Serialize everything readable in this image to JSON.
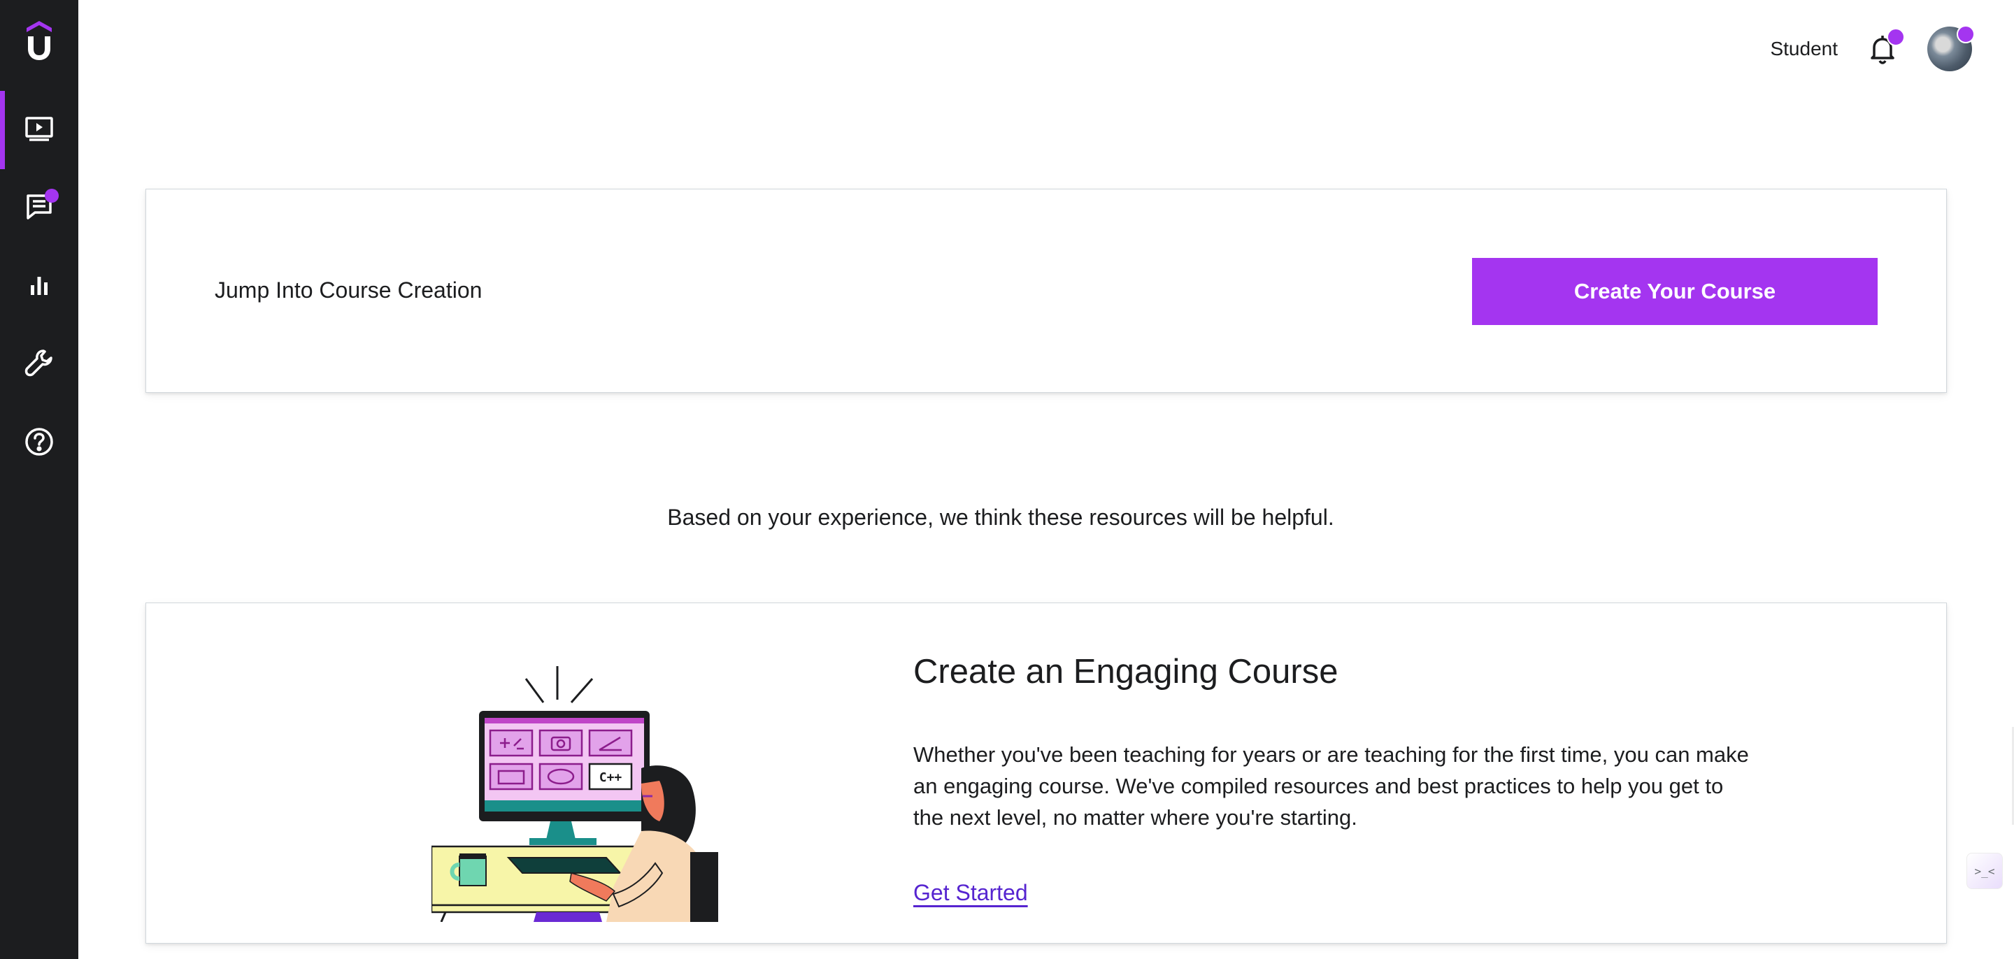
{
  "app": {
    "brand_letter": "U"
  },
  "colors": {
    "accent": "#a435f0",
    "sidebar_bg": "#1c1d1f",
    "link": "#5624d0"
  },
  "sidebar": {
    "items": [
      {
        "icon": "video-course-icon",
        "active": true
      },
      {
        "icon": "messages-icon",
        "has_notification": true
      },
      {
        "icon": "bar-chart-icon"
      },
      {
        "icon": "wrench-tools-icon"
      },
      {
        "icon": "help-circle-icon"
      }
    ]
  },
  "header": {
    "role_link": "Student",
    "bell_icon": "bell-icon",
    "avatar": "user-avatar"
  },
  "cta_card": {
    "text": "Jump Into Course Creation",
    "button_label": "Create Your Course"
  },
  "helpful_text": "Based on your experience, we think these resources will be helpful.",
  "resource_card": {
    "title": "Create an Engaging Course",
    "description": "Whether you've been teaching for years or are teaching for the first time, you can make an engaging course. We've compiled resources and best practices to help you get to the next level, no matter where you're starting.",
    "link_label": "Get Started",
    "illustration": "person-at-computer-illustration",
    "screen_tile_label": "C++"
  },
  "float_widget": {
    "label": ">_<"
  }
}
